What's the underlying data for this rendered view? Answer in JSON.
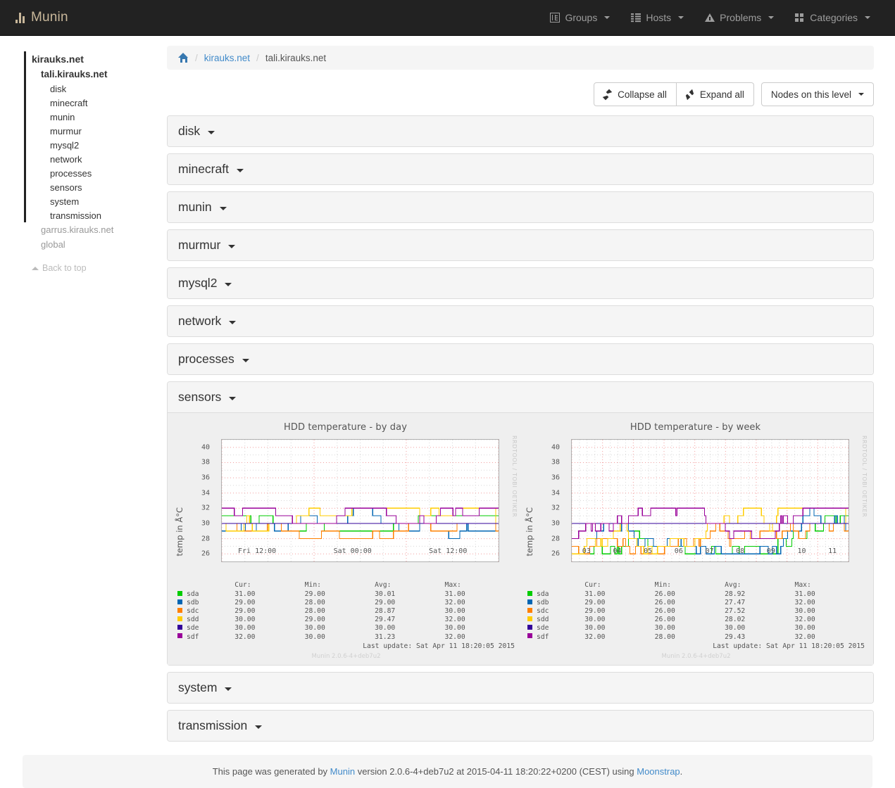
{
  "navbar": {
    "brand": "Munin",
    "brand_icon": "bar-chart-icon",
    "items": [
      {
        "label": "Groups",
        "icon": "groups-icon"
      },
      {
        "label": "Hosts",
        "icon": "hosts-list-icon"
      },
      {
        "label": "Problems",
        "icon": "warning-triangle-icon"
      },
      {
        "label": "Categories",
        "icon": "categories-grid-icon"
      }
    ]
  },
  "sidebar": {
    "root": "kirauks.net",
    "node": "tali.kirauks.net",
    "leaves": [
      "disk",
      "minecraft",
      "munin",
      "murmur",
      "mysql2",
      "network",
      "processes",
      "sensors",
      "system",
      "transmission"
    ],
    "other_nodes": [
      "garrus.kirauks.net",
      "global"
    ],
    "back_to_top": "Back to top"
  },
  "breadcrumb": {
    "home_icon": "home-icon",
    "separator": "/",
    "group": "kirauks.net",
    "host": "tali.kirauks.net"
  },
  "toolbar": {
    "collapse_all": "Collapse all",
    "expand_all": "Expand all",
    "nodes_on_level": "Nodes on this level"
  },
  "panels": [
    {
      "label": "disk",
      "open": false
    },
    {
      "label": "minecraft",
      "open": false
    },
    {
      "label": "munin",
      "open": false
    },
    {
      "label": "murmur",
      "open": false
    },
    {
      "label": "mysql2",
      "open": false
    },
    {
      "label": "network",
      "open": false
    },
    {
      "label": "processes",
      "open": false
    },
    {
      "label": "sensors",
      "open": true
    },
    {
      "label": "system",
      "open": false
    },
    {
      "label": "transmission",
      "open": false
    }
  ],
  "footer": {
    "text_1": "This page was generated by ",
    "link_munin": "Munin",
    "text_2": " version 2.0.6-4+deb7u2 at 2015-04-11 18:20:22+0200 (CEST) using ",
    "link_moonstrap": "Moonstrap",
    "text_3": "."
  },
  "colors": {
    "sda": "#00cc00",
    "sdb": "#0066b3",
    "sdc": "#ff8000",
    "sdd": "#ffcc00",
    "sde": "#330099",
    "sdf": "#990099",
    "brand": "#c8b79a",
    "navbar_bg": "#222222",
    "link": "#428bca",
    "panel_head_bg": "#f5f5f5",
    "graph_bg": "#efefef"
  },
  "chart_data": [
    {
      "type": "line",
      "title": "HDD temperature - by day",
      "xlabel": "",
      "ylabel": "temp in Å°C",
      "ylim": [
        25,
        41
      ],
      "yticks": [
        26,
        28,
        30,
        32,
        34,
        36,
        38,
        40
      ],
      "xticks": [
        "Fri 12:00",
        "Sat 00:00",
        "Sat 12:00"
      ],
      "grid": true,
      "watermark": "RRDTOOL / TOBI OETIKER",
      "legend_headers": [
        "Cur:",
        "Min:",
        "Avg:",
        "Max:"
      ],
      "series": [
        {
          "name": "sda",
          "color": "#00cc00",
          "cur": "31.00",
          "min": "29.00",
          "avg": "30.01",
          "max": "31.00"
        },
        {
          "name": "sdb",
          "color": "#0066b3",
          "cur": "29.00",
          "min": "28.00",
          "avg": "29.00",
          "max": "32.00"
        },
        {
          "name": "sdc",
          "color": "#ff8000",
          "cur": "29.00",
          "min": "28.00",
          "avg": "28.87",
          "max": "30.00"
        },
        {
          "name": "sdd",
          "color": "#ffcc00",
          "cur": "30.00",
          "min": "29.00",
          "avg": "29.47",
          "max": "32.00"
        },
        {
          "name": "sde",
          "color": "#330099",
          "cur": "30.00",
          "min": "30.00",
          "avg": "30.00",
          "max": "30.00"
        },
        {
          "name": "sdf",
          "color": "#990099",
          "cur": "32.00",
          "min": "30.00",
          "avg": "31.23",
          "max": "32.00"
        }
      ],
      "last_update": "Last update: Sat Apr 11 18:20:05 2015",
      "version": "Munin 2.0.6-4+deb7u2"
    },
    {
      "type": "line",
      "title": "HDD temperature - by week",
      "xlabel": "",
      "ylabel": "temp in Å°C",
      "ylim": [
        25,
        41
      ],
      "yticks": [
        26,
        28,
        30,
        32,
        34,
        36,
        38,
        40
      ],
      "xticks": [
        "03",
        "04",
        "05",
        "06",
        "07",
        "08",
        "09",
        "10",
        "11"
      ],
      "grid": true,
      "watermark": "RRDTOOL / TOBI OETIKER",
      "legend_headers": [
        "Cur:",
        "Min:",
        "Avg:",
        "Max:"
      ],
      "series": [
        {
          "name": "sda",
          "color": "#00cc00",
          "cur": "31.00",
          "min": "26.00",
          "avg": "28.92",
          "max": "31.00"
        },
        {
          "name": "sdb",
          "color": "#0066b3",
          "cur": "29.00",
          "min": "26.00",
          "avg": "27.47",
          "max": "32.00"
        },
        {
          "name": "sdc",
          "color": "#ff8000",
          "cur": "29.00",
          "min": "26.00",
          "avg": "27.52",
          "max": "30.00"
        },
        {
          "name": "sdd",
          "color": "#ffcc00",
          "cur": "30.00",
          "min": "26.00",
          "avg": "28.02",
          "max": "32.00"
        },
        {
          "name": "sde",
          "color": "#330099",
          "cur": "30.00",
          "min": "30.00",
          "avg": "30.00",
          "max": "30.00"
        },
        {
          "name": "sdf",
          "color": "#990099",
          "cur": "32.00",
          "min": "28.00",
          "avg": "29.43",
          "max": "32.00"
        }
      ],
      "last_update": "Last update: Sat Apr 11 18:20:05 2015",
      "version": "Munin 2.0.6-4+deb7u2"
    }
  ]
}
